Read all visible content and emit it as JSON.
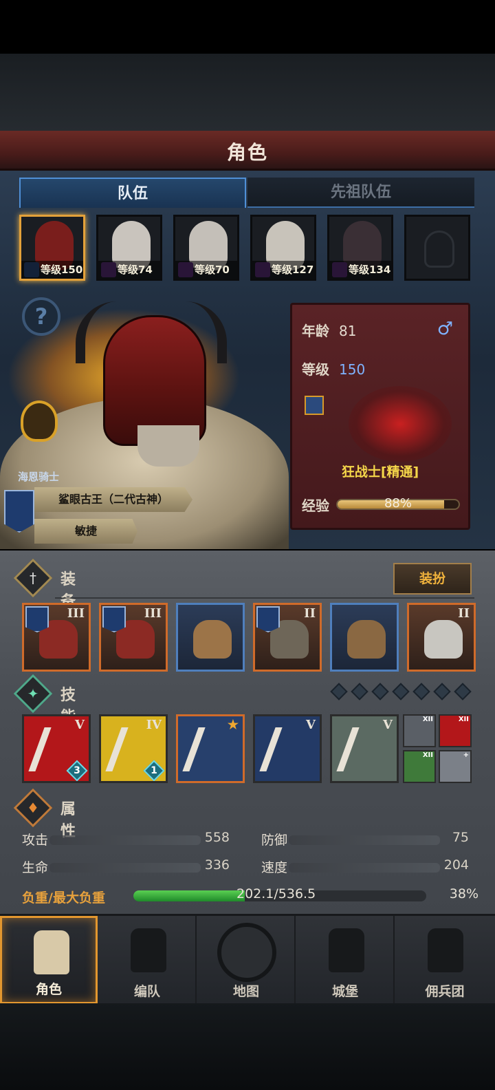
{
  "screen_title": "角色",
  "tabs": [
    {
      "label": "队伍",
      "active": true
    },
    {
      "label": "先祖队伍",
      "active": false
    }
  ],
  "roster": [
    {
      "level_text": "等级150",
      "selected": true,
      "face_color": "#7a1e1c"
    },
    {
      "level_text": "等级74",
      "selected": false,
      "face_color": "#c9c4bd"
    },
    {
      "level_text": "等级70",
      "selected": false,
      "face_color": "#c4bfb8"
    },
    {
      "level_text": "等级127",
      "selected": false,
      "face_color": "#c8c3ba"
    },
    {
      "level_text": "等级134",
      "selected": false,
      "face_color": "#3a2f35"
    }
  ],
  "hero": {
    "class_label": "海恩骑士",
    "trait_primary": "鲨眼古王（二代古神）",
    "trait_secondary": "敏捷"
  },
  "info_card": {
    "age_label": "年龄",
    "age_value": "81",
    "gender_symbol": "♂",
    "level_label": "等级",
    "level_value": "150",
    "job": "狂战士[精通]",
    "exp_label": "经验",
    "exp_percent_text": "88%",
    "exp_fraction": 0.88
  },
  "equipment": {
    "title": "装备",
    "dress_button": "装扮",
    "items": [
      {
        "tier": "III",
        "flag": true,
        "border": "gold",
        "art_color": "#8c2a24"
      },
      {
        "tier": "III",
        "flag": true,
        "border": "gold",
        "art_color": "#8c2a24"
      },
      {
        "tier": "",
        "flag": false,
        "border": "blue",
        "art_color": "#9c7448"
      },
      {
        "tier": "II",
        "flag": true,
        "border": "gold",
        "art_color": "#6e6658"
      },
      {
        "tier": "",
        "flag": false,
        "border": "blue",
        "art_color": "#8a6842"
      },
      {
        "tier": "II",
        "flag": false,
        "border": "gold",
        "art_color": "#c8c6c0"
      }
    ]
  },
  "skills": {
    "title": "技能",
    "items": [
      {
        "tier": "V",
        "level": "3",
        "bg": "#b3171a",
        "gold": false
      },
      {
        "tier": "IV",
        "level": "1",
        "bg": "#d8b21e",
        "gold": false
      },
      {
        "tier": "",
        "level": "",
        "bg": "#27406c",
        "gold": true
      },
      {
        "tier": "V",
        "level": "",
        "bg": "#233a66",
        "gold": false
      },
      {
        "tier": "V",
        "level": "",
        "bg": "#5b6a62",
        "gold": false
      }
    ],
    "mini": [
      {
        "tier": "XII",
        "bg": "#5a5f66"
      },
      {
        "tier": "XII",
        "bg": "#b3171a"
      },
      {
        "tier": "XII",
        "bg": "#3f7a3a"
      },
      {
        "tier": "+",
        "bg": "#7b8088"
      }
    ]
  },
  "attributes": {
    "title": "属性",
    "attack_label": "攻击",
    "attack_value": "558",
    "defense_label": "防御",
    "defense_value": "75",
    "hp_label": "生命",
    "hp_value": "336",
    "speed_label": "速度",
    "speed_value": "204",
    "load_label": "负重/最大负重",
    "load_value": "202.1/536.5",
    "load_percent_text": "38%",
    "load_fraction": 0.38
  },
  "nav": [
    {
      "label": "角色",
      "active": true
    },
    {
      "label": "编队",
      "active": false
    },
    {
      "label": "地图",
      "active": false
    },
    {
      "label": "城堡",
      "active": false
    },
    {
      "label": "佣兵团",
      "active": false
    }
  ]
}
